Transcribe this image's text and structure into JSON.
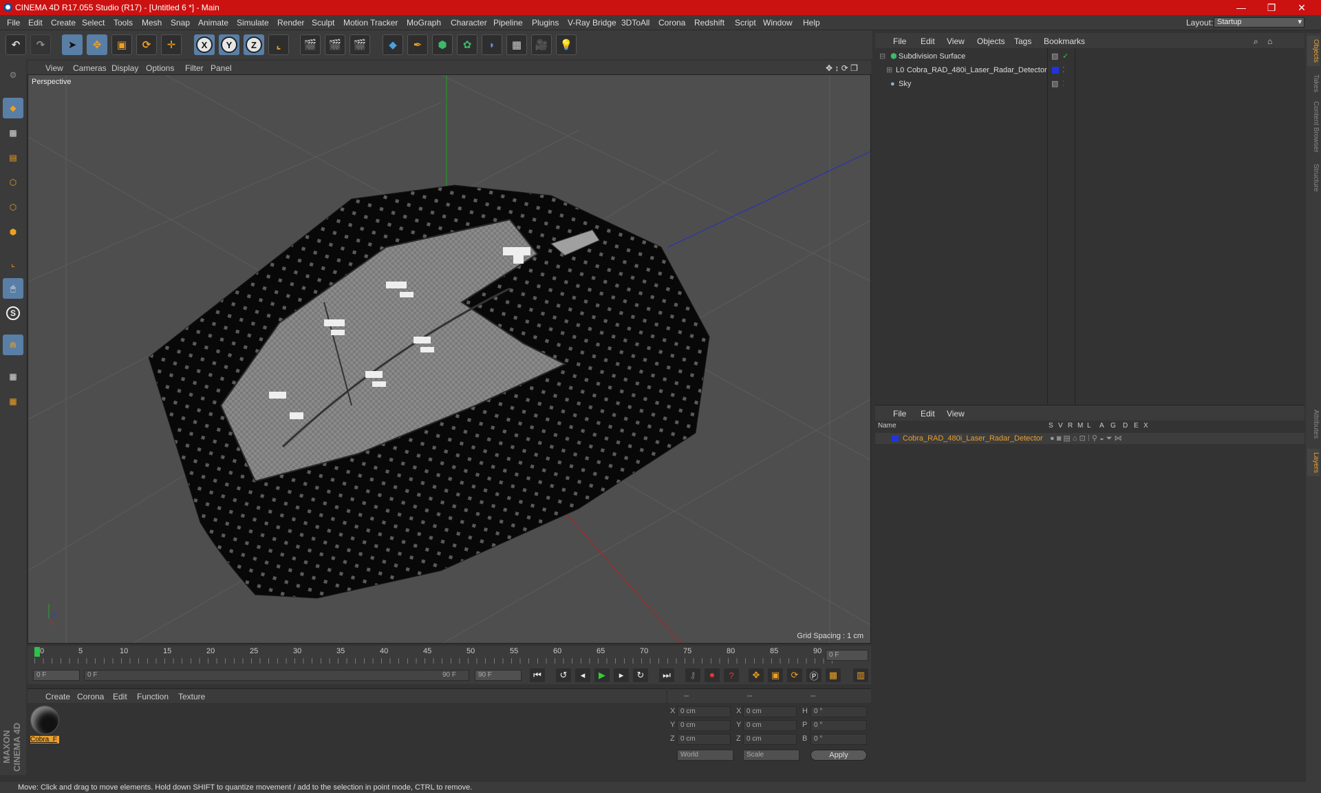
{
  "app": {
    "title": "CINEMA 4D R17.055 Studio (R17) - [Untitled 6 *] - Main",
    "window_controls": [
      "—",
      "❐",
      "✕"
    ]
  },
  "menubar": {
    "items": [
      "File",
      "Edit",
      "Create",
      "Select",
      "Tools",
      "Mesh",
      "Snap",
      "Animate",
      "Simulate",
      "Render",
      "Sculpt",
      "Motion Tracker",
      "MoGraph",
      "Character",
      "Pipeline",
      "Plugins",
      "V-Ray Bridge",
      "3DToAll",
      "Corona",
      "Redshift",
      "Script",
      "Window",
      "Help"
    ],
    "layout_label": "Layout:",
    "layout_value": "Startup"
  },
  "toolbar": {
    "axis_x": "X",
    "axis_y": "Y",
    "axis_z": "Z"
  },
  "viewport": {
    "menu": [
      "View",
      "Cameras",
      "Display",
      "Options",
      "Filter",
      "Panel"
    ],
    "label": "Perspective",
    "grid_spacing": "Grid Spacing : 1 cm"
  },
  "timeline": {
    "ticks": [
      "0",
      "5",
      "10",
      "15",
      "20",
      "25",
      "30",
      "35",
      "40",
      "45",
      "50",
      "55",
      "60",
      "65",
      "70",
      "75",
      "80",
      "85",
      "90"
    ],
    "current_frame": "0 F",
    "start_field": "0 F",
    "range_start": "0 F",
    "range_end": "90 F",
    "end_field": "90 F"
  },
  "material_manager": {
    "menu": [
      "Create",
      "Corona",
      "Edit",
      "Function",
      "Texture"
    ],
    "material_name": "Cobra_F"
  },
  "attributes": {
    "header": [
      "--",
      "--",
      "--"
    ],
    "rows": [
      {
        "a": "X",
        "av": "0 cm",
        "b": "X",
        "bv": "0 cm",
        "c": "H",
        "cv": "0 °"
      },
      {
        "a": "Y",
        "av": "0 cm",
        "b": "Y",
        "bv": "0 cm",
        "c": "P",
        "cv": "0 °"
      },
      {
        "a": "Z",
        "av": "0 cm",
        "b": "Z",
        "bv": "0 cm",
        "c": "B",
        "cv": "0 °"
      }
    ],
    "coord_mode": "World",
    "size_mode": "Scale",
    "apply_label": "Apply"
  },
  "object_manager": {
    "menu": [
      "File",
      "Edit",
      "View",
      "Objects",
      "Tags",
      "Bookmarks"
    ],
    "objects": [
      {
        "name": "Subdivision Surface",
        "color": "#3fb86b"
      },
      {
        "name": "Cobra_RAD_480i_Laser_Radar_Detector",
        "color": "#2233dd"
      },
      {
        "name": "Sky",
        "color": "#8fb0d6"
      }
    ]
  },
  "layer_manager": {
    "menu": [
      "File",
      "Edit",
      "View"
    ],
    "columns": [
      "Name",
      "S",
      "V",
      "R",
      "M",
      "L",
      "A",
      "G",
      "D",
      "E",
      "X"
    ],
    "layers": [
      {
        "name": "Cobra_RAD_480i_Laser_Radar_Detector",
        "color": "#2233dd"
      }
    ]
  },
  "right_tabs": [
    "Objects",
    "Takes",
    "Content Browser",
    "Structure",
    "Attributes",
    "Layers"
  ],
  "status": "Move: Click and drag to move elements. Hold down SHIFT to quantize movement / add to the selection in point mode, CTRL to remove.",
  "maxon": "MAXON CINEMA 4D",
  "colors": {
    "accent": "#cc1111",
    "tool_blue": "#5a7fa6",
    "highlight_orange": "#e8a030"
  }
}
